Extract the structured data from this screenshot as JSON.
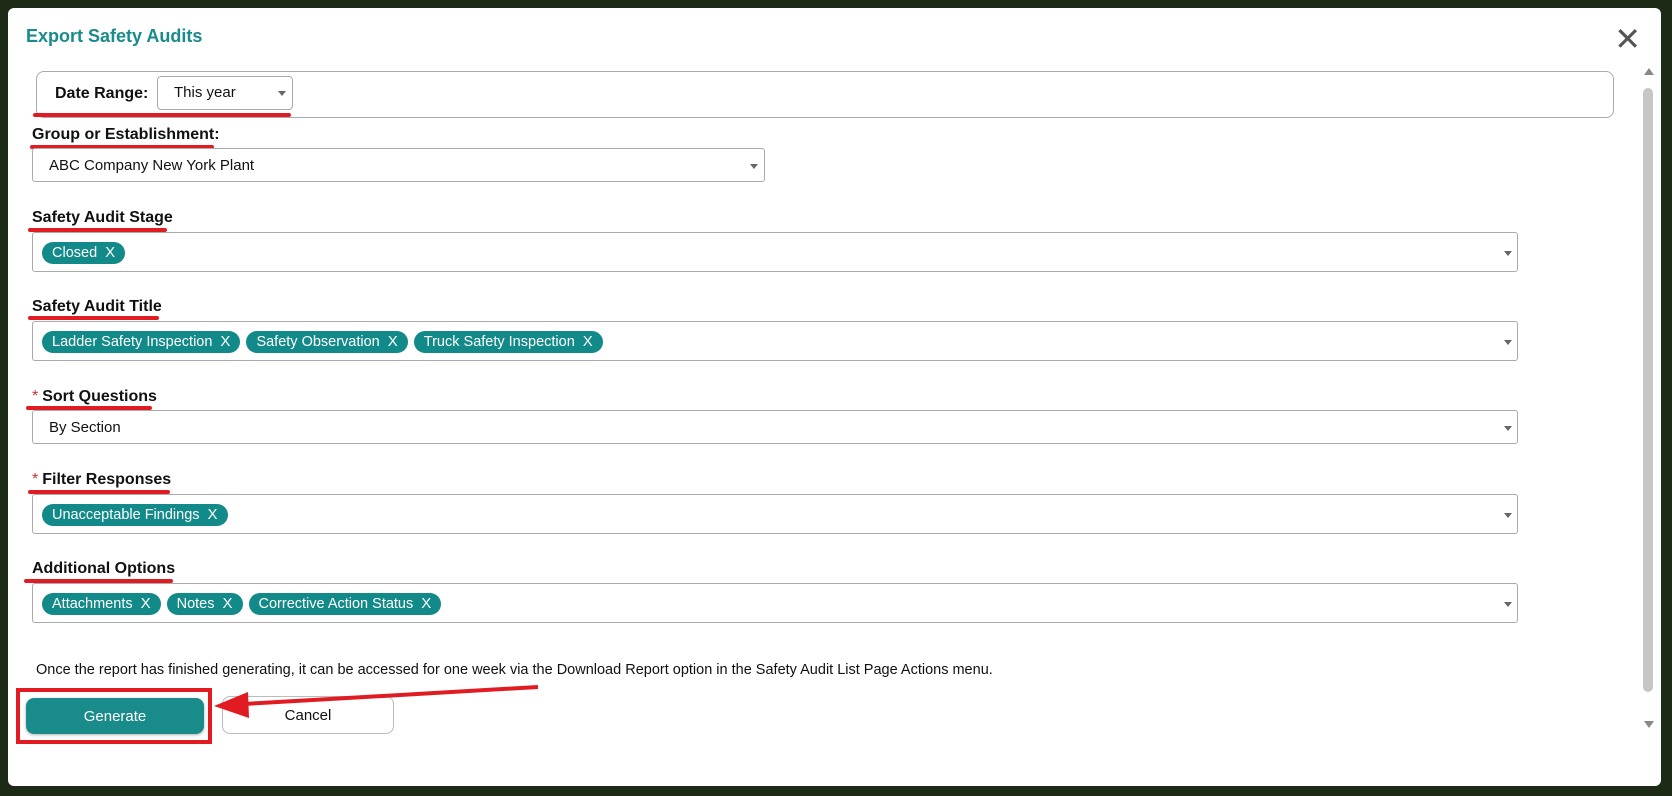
{
  "dialog": {
    "title": "Export Safety Audits",
    "close_icon": "close-icon"
  },
  "date_range": {
    "label": "Date Range:",
    "value": "This year"
  },
  "group": {
    "label": "Group or Establishment:",
    "value": "ABC Company New York Plant"
  },
  "stage": {
    "label": "Safety Audit Stage",
    "chips": [
      "Closed"
    ]
  },
  "audit_title": {
    "label": "Safety Audit Title",
    "chips": [
      "Ladder Safety Inspection",
      "Safety Observation",
      "Truck Safety Inspection"
    ]
  },
  "sort_questions": {
    "required_mark": "*",
    "label": "Sort Questions",
    "value": "By Section"
  },
  "filter_responses": {
    "required_mark": "*",
    "label": "Filter Responses",
    "chips": [
      "Unacceptable Findings"
    ]
  },
  "additional_options": {
    "label": "Additional Options",
    "chips": [
      "Attachments",
      "Notes",
      "Corrective Action Status"
    ]
  },
  "chip_remove": "X",
  "note": "Once the report has finished generating, it can be accessed for one week via the Download Report option in the Safety Audit List Page Actions menu.",
  "buttons": {
    "generate": "Generate",
    "cancel": "Cancel"
  },
  "colors": {
    "accent": "#1a8b8b",
    "highlight": "#e11b22"
  }
}
